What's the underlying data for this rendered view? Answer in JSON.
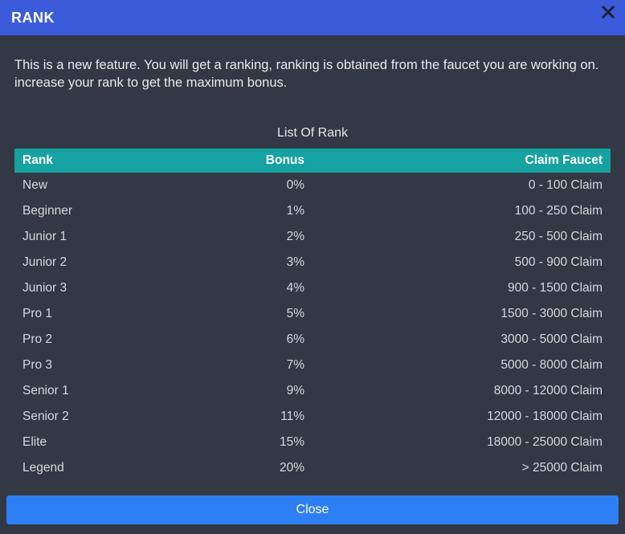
{
  "header": {
    "title": "RANK"
  },
  "intro": "This is a new feature. You will get a ranking, ranking is obtained from the faucet you are working on. increase your rank to get the maximum bonus.",
  "list_title": "List Of Rank",
  "columns": {
    "rank": "Rank",
    "bonus": "Bonus",
    "claim": "Claim Faucet"
  },
  "rows": [
    {
      "rank": "New",
      "bonus": "0%",
      "claim": "0 - 100 Claim"
    },
    {
      "rank": "Beginner",
      "bonus": "1%",
      "claim": "100 - 250 Claim"
    },
    {
      "rank": "Junior 1",
      "bonus": "2%",
      "claim": "250 - 500 Claim"
    },
    {
      "rank": "Junior 2",
      "bonus": "3%",
      "claim": "500 - 900 Claim"
    },
    {
      "rank": "Junior 3",
      "bonus": "4%",
      "claim": "900 - 1500 Claim"
    },
    {
      "rank": "Pro 1",
      "bonus": "5%",
      "claim": "1500 - 3000 Claim"
    },
    {
      "rank": "Pro 2",
      "bonus": "6%",
      "claim": "3000 - 5000 Claim"
    },
    {
      "rank": "Pro 3",
      "bonus": "7%",
      "claim": "5000 - 8000 Claim"
    },
    {
      "rank": "Senior 1",
      "bonus": "9%",
      "claim": "8000 - 12000 Claim"
    },
    {
      "rank": "Senior 2",
      "bonus": "11%",
      "claim": "12000 - 18000 Claim"
    },
    {
      "rank": "Elite",
      "bonus": "15%",
      "claim": "18000 - 25000 Claim"
    },
    {
      "rank": "Legend",
      "bonus": "20%",
      "claim": "> 25000 Claim"
    }
  ],
  "footer": {
    "close_label": "Close"
  }
}
